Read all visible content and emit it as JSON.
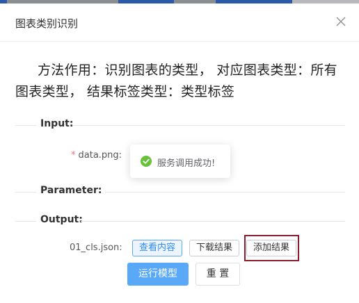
{
  "dialog": {
    "title": "图表类别识别",
    "description": "方法作用：识别图表的类型， 对应图表类型：所有图表类型， 结果标签类型：类型标签"
  },
  "sections": {
    "input": "Input:",
    "parameter": "Parameter:",
    "output": "Output:"
  },
  "input_field": {
    "required_mark": "*",
    "label": "data.png:"
  },
  "toast": {
    "message": "服务调用成功!"
  },
  "output_field": {
    "label": "01_cls.json:",
    "view_button": "查看内容",
    "download_button": "下载结果",
    "add_button": "添加结果"
  },
  "actions": {
    "run_button": "运行模型",
    "reset_button": "重 置"
  },
  "icons": {
    "close": "close-icon",
    "success": "check-circle-icon"
  },
  "colors": {
    "primary": "#59a9f8",
    "success": "#67c23a",
    "highlight_frame": "#8b1c2b"
  }
}
